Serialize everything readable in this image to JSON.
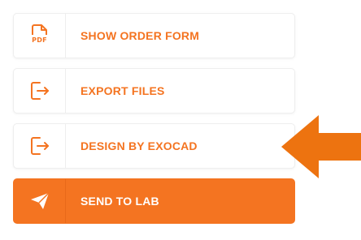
{
  "actions": [
    {
      "label": "SHOW ORDER FORM",
      "icon": "pdf-file-icon",
      "icon_text": "PDF"
    },
    {
      "label": "EXPORT FILES",
      "icon": "export-icon"
    },
    {
      "label": "DESIGN BY EXOCAD",
      "icon": "export-icon"
    },
    {
      "label": "SEND TO LAB",
      "icon": "paper-plane-icon"
    }
  ],
  "colors": {
    "accent": "#f47421",
    "pointer": "#ed7310",
    "border": "#eeeeee",
    "background": "#ffffff"
  }
}
